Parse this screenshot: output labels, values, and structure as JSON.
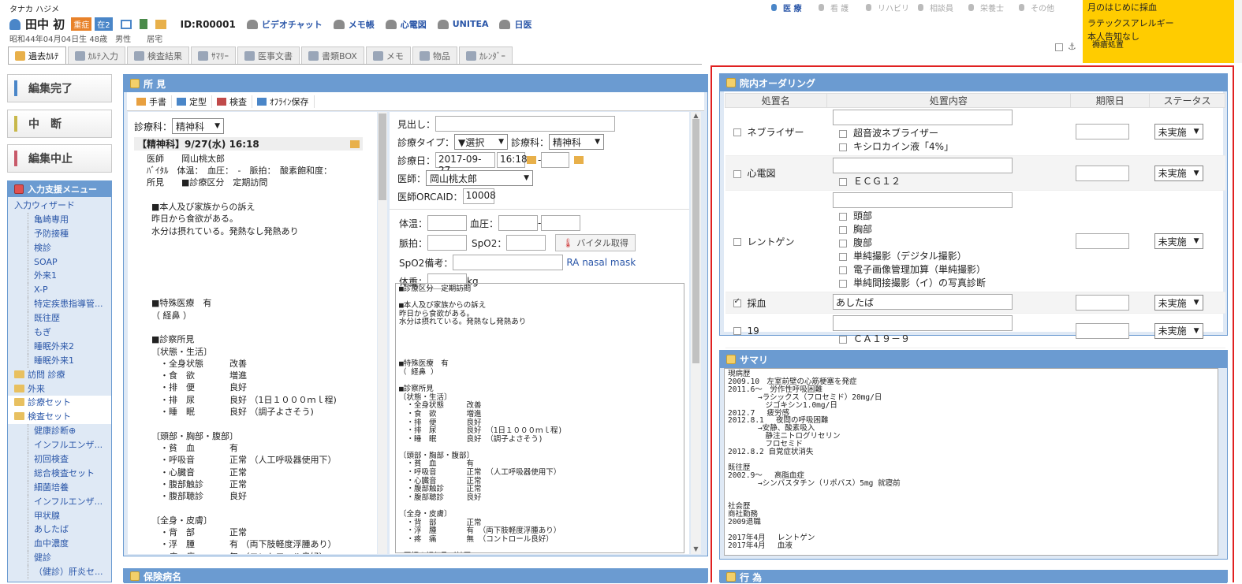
{
  "header": {
    "kana": "タナカ ハジメ",
    "name": "田中 初",
    "badge_severe": "重症",
    "badge_home": "在2",
    "birth": "昭和44年04月04日生 48歳　男性　　居宅",
    "patient_id": "ID:R00001",
    "links": [
      "ビデオチャット",
      "メモ帳",
      "心電図",
      "UNITEA",
      "日医"
    ],
    "roles": [
      "医 療",
      "看 護",
      "リハビリ",
      "相談員",
      "栄養士",
      "その他"
    ],
    "notice": [
      "月のはじめに採血",
      "ラテックスアレルギー",
      "本人告知なし",
      "褥瘡処置"
    ],
    "colors": {
      "notice_bg": "#ffcc00",
      "accent": "#2a56a8",
      "frame_red": "#e02020"
    }
  },
  "tabs": [
    "過去ｶﾙﾃ",
    "ｶﾙﾃ入力",
    "検査結果",
    "ｻﾏﾘｰ",
    "医事文書",
    "書類BOX",
    "メモ",
    "物品",
    "ｶﾚﾝﾀﾞｰ"
  ],
  "side": {
    "buttons": [
      {
        "label": "編集完了",
        "color": "#4a86c8"
      },
      {
        "label": "中　断",
        "color": "#c8b84a"
      },
      {
        "label": "編集中止",
        "color": "#c85a6a"
      }
    ],
    "menu_title": "入力支援メニュー",
    "tree": [
      {
        "t": "入力ウィザード",
        "k": "wizard"
      },
      {
        "t": "亀崎専用",
        "k": "child"
      },
      {
        "t": "予防接種",
        "k": "child"
      },
      {
        "t": "検診",
        "k": "child"
      },
      {
        "t": "SOAP",
        "k": "child"
      },
      {
        "t": "外来1",
        "k": "child"
      },
      {
        "t": "X-P",
        "k": "child"
      },
      {
        "t": "特定疾患指導管...",
        "k": "child"
      },
      {
        "t": "既往歴",
        "k": "child"
      },
      {
        "t": "もぎ",
        "k": "child"
      },
      {
        "t": "睡眠外来2",
        "k": "child"
      },
      {
        "t": "睡眠外来1",
        "k": "child"
      },
      {
        "t": "訪問 診療",
        "k": "folder"
      },
      {
        "t": "外来",
        "k": "folder"
      },
      {
        "t": "診療セット",
        "k": "folder"
      },
      {
        "t": "検査セット",
        "k": "folder"
      },
      {
        "t": "健康診断⊕",
        "k": "child"
      },
      {
        "t": "インフルエンザ...",
        "k": "child"
      },
      {
        "t": "初回検査",
        "k": "child"
      },
      {
        "t": "総合検査セット",
        "k": "child"
      },
      {
        "t": "細菌培養",
        "k": "child"
      },
      {
        "t": "インフルエンザ...",
        "k": "child"
      },
      {
        "t": "甲状腺",
        "k": "child"
      },
      {
        "t": "あしたば",
        "k": "child"
      },
      {
        "t": "血中濃度",
        "k": "child"
      },
      {
        "t": "健診",
        "k": "child"
      },
      {
        "t": "（健診）肝炎セ...",
        "k": "child"
      }
    ]
  },
  "findings": {
    "title": "所 見",
    "toolbar": [
      "手書",
      "定型",
      "検査",
      "ｵﾌﾗｲﾝ保存"
    ],
    "dept_label": "診療科：",
    "dept_value": "精神科",
    "entry_header": "【精神科】9/27(水) 16:18",
    "doctor_line": "医師　　岡山桃太郎",
    "vital_line": "ﾊﾞｲﾀﾙ　体温：　血圧：　-　脈拍：　酸素飽和度：",
    "finding_line": "所見　　■診療区分　定期訪問",
    "left_text": "■本人及び家族からの訴え\n昨日から食欲がある。\n水分は摂れている。発熱なし発熱あり\n\n\n\n\n\n■特殊医療　有\n（ 経鼻 ）\n\n■診察所見\n〔状態・生活〕\n　・全身状態　　　改善\n　・食　欲　　　　増進\n　・排　便　　　　良好\n　・排　尿　　　　良好 （1日１０００ｍｌ程)\n　・睡　眠　　　　良好 （調子よさそう)\n\n〔頭部・胸部・腹部〕\n　・貧　血　　　　有\n　・呼吸音　　　　正常 （人工呼吸器使用下）\n　・心臓音　　　　正常\n　・腹部触診　　　正常\n　・腹部聴診　　　良好\n\n〔全身・皮膚〕\n　・背　部　　　　正常\n　・浮　腫　　　　有 （両下肢軽度浮腫あり）\n　・疼　痛　　　　無 （コントロール良好）",
    "form": {
      "heading_label": "見出し：",
      "type_label": "診療タイプ：",
      "type_value": "▼選択",
      "dept_label": "診療科：",
      "dept_value": "精神科",
      "date_label": "診療日：",
      "date_value": "2017-09-27",
      "time_value": "16:18",
      "date_sep": "-",
      "doctor_label": "医師：",
      "doctor_value": "岡山桃太郎",
      "orca_label": "医師ORCAID：",
      "orca_value": "10008",
      "temp_label": "体温：",
      "bp_label": "血圧：",
      "bp_sep": "-",
      "pulse_label": "脈拍：",
      "spo2_label": "SpO2：",
      "vital_button": "バイタル取得",
      "spo2_note_label": "SpO2備考：",
      "spo2_note_value": "RA nasal mask",
      "weight_label": "体重：",
      "weight_unit": "kg"
    },
    "right_text": "■診療区分　定期訪問\n\n■本人及び家族からの訴え\n昨日から食欲がある。\n水分は摂れている。発熱なし発熱あり\n\n\n\n\n■特殊医療　有\n（ 経鼻 ）\n\n■診察所見\n〔状態・生活〕\n　・全身状態　　　改善\n　・食　欲　　　　増進\n　・排　便　　　　良好\n　・排　尿　　　　良好 （1日１０００ｍｌ程)\n　・睡　眠　　　　良好 （調子よさそう)\n\n〔頭部・胸部・腹部〕\n　・貧　血　　　　有\n　・呼吸音　　　　正常 （人工呼吸器使用下）\n　・心臓音　　　　正常\n　・腹部触診　　　正常\n　・腹部聴診　　　良好\n\n〔全身・皮膚〕\n　・背　部　　　　正常\n　・浮　腫　　　　有 （両下肢軽度浮腫あり）\n　・疼　痛　　　　無 （コントロール良好）\n\n■医師の評価及び計画\n経過観察とする"
  },
  "insurance_title": "保険病名",
  "ordering": {
    "title": "院内オーダリング",
    "columns": [
      "処置名",
      "処置内容",
      "期限日",
      "ステータス"
    ],
    "rows": [
      {
        "name": "ネブライザー",
        "checked": false,
        "text": "",
        "options": [
          "超音波ネブライザー",
          "キシロカイン液「4%」"
        ],
        "status": "未実施"
      },
      {
        "name": "心電図",
        "checked": false,
        "text": "",
        "options": [
          "ＥＣＧ１２"
        ],
        "status": "未実施"
      },
      {
        "name": "レントゲン",
        "checked": false,
        "text": "",
        "options": [
          "頭部",
          "胸部",
          "腹部",
          "単純撮影（デジタル撮影）",
          "電子画像管理加算（単純撮影）",
          "単純間接撮影（イ）の写真診断"
        ],
        "status": "未実施"
      },
      {
        "name": "採血",
        "checked": true,
        "text": "あしたば",
        "options": [],
        "status": "未実施"
      },
      {
        "name": "19",
        "checked": false,
        "text": "",
        "options": [
          "ＣＡ１９－９"
        ],
        "status": "未実施"
      }
    ]
  },
  "summary": {
    "title": "サマリ",
    "text": "現病歴\n2009.10　左室前壁の心筋梗塞を発症\n2011.6～　労作性呼吸困難\n　　　　→ラシックス（フロセミド）20mg/日\n　　　　　ジゴキシン1.0mg/日\n2012.7　 疲労感\n2012.8.1 　夜間の呼吸困難\n　　　　→安静、酸素吸入\n　　　　　静注ニトログリセリン\n　　　　　フロセミド\n2012.8.2 自覚症状消失\n\n既往歴\n2002.9～　 高脂血症\n　　　　→シンバスタチン（リポバス）5mg 就寝前\n\n\n社会歴\n商社勤務\n2009退職\n\n2017年4月　 レントゲン\n2017年4月　 血液"
  },
  "bottom_right_title": "行 為"
}
